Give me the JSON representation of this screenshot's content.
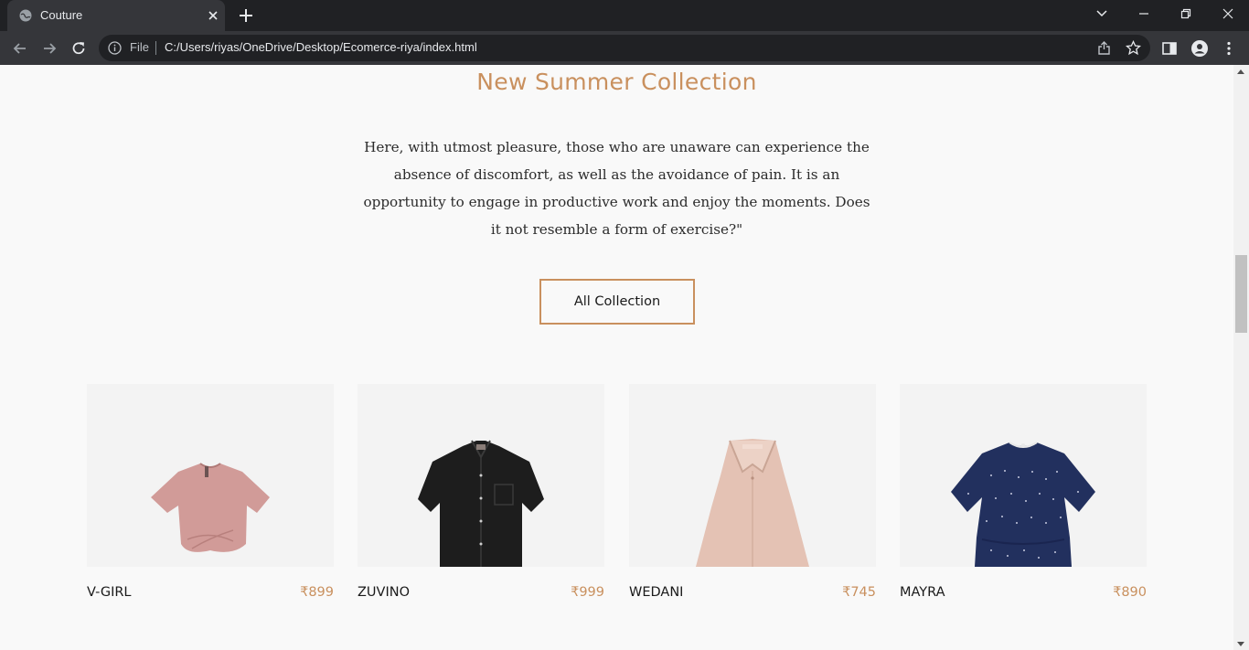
{
  "browser": {
    "tab_title": "Couture",
    "omnibox_scheme_label": "File",
    "url": "C:/Users/riyas/OneDrive/Desktop/Ecomerce-riya/index.html"
  },
  "collection": {
    "heading": "New Summer Collection",
    "description": "Here, with utmost pleasure, those who are unaware can experience the absence of discomfort, as well as the avoidance of pain. It is an opportunity to engage in productive work and enjoy the moments. Does it not resemble a form of exercise?\"",
    "button_label": "All Collection"
  },
  "products": [
    {
      "name": "V-GIRL",
      "price": "₹899"
    },
    {
      "name": "ZUVINO",
      "price": "₹999"
    },
    {
      "name": "WEDANI",
      "price": "₹745"
    },
    {
      "name": "MAYRA",
      "price": "₹890"
    }
  ],
  "colors": {
    "accent": "#c9905e",
    "page_bg": "#f9f9f9",
    "card_bg": "#f3f3f3",
    "chrome_dark": "#202124",
    "chrome_mid": "#35363a"
  }
}
